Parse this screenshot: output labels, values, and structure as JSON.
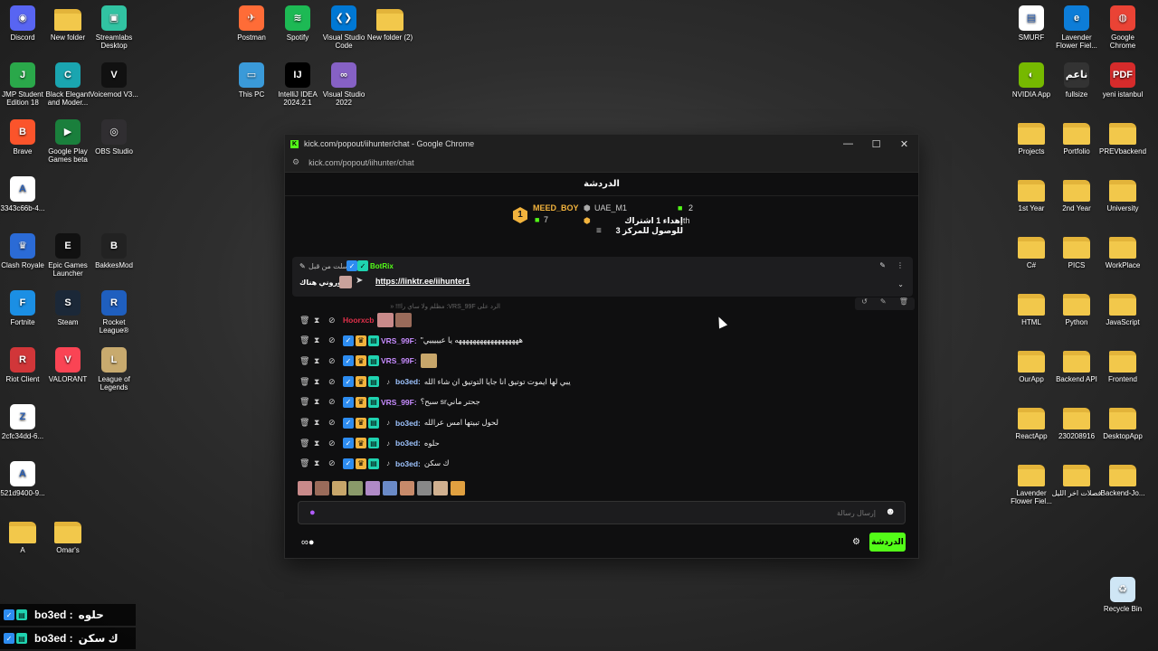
{
  "desktop_left": [
    {
      "label": "Discord",
      "color": "#5865f2",
      "glyph": "◉"
    },
    {
      "label": "New folder",
      "folder": true
    },
    {
      "label": "Streamlabs Desktop",
      "color": "#31c3a2",
      "glyph": "▣"
    },
    {
      "label": "JMP Student Edition 18",
      "color": "#2aa84a",
      "glyph": "J"
    },
    {
      "label": "Black Elegant and Moder...",
      "color": "#1aa5b0",
      "glyph": "C"
    },
    {
      "label": "Voicemod V3...",
      "color": "#111111",
      "glyph": "V"
    },
    {
      "label": "Brave",
      "color": "#fb542b",
      "glyph": "B"
    },
    {
      "label": "Google Play Games beta",
      "color": "#1a7f3c",
      "glyph": "▶"
    },
    {
      "label": "OBS Studio",
      "color": "#302e31",
      "glyph": "◎"
    },
    {
      "label": "3343c66b-4...",
      "color": "#ffffff",
      "glyph": "A"
    },
    {
      "label": "Clash Royale",
      "color": "#2b6bd6",
      "glyph": "♛"
    },
    {
      "label": "Epic Games Launcher",
      "color": "#111111",
      "glyph": "E"
    },
    {
      "label": "BakkesMod",
      "color": "#222222",
      "glyph": "B"
    },
    {
      "label": "Fortnite",
      "color": "#1b8fe4",
      "glyph": "F"
    },
    {
      "label": "Steam",
      "color": "#1b2838",
      "glyph": "S"
    },
    {
      "label": "Rocket League®",
      "color": "#1f5fbf",
      "glyph": "R"
    },
    {
      "label": "Riot Client",
      "color": "#d13639",
      "glyph": "R"
    },
    {
      "label": "VALORANT",
      "color": "#fa4454",
      "glyph": "V"
    },
    {
      "label": "League of Legends",
      "color": "#c8aa6e",
      "glyph": "L"
    },
    {
      "label": "2cfc34dd-6...",
      "color": "#ffffff",
      "glyph": "Z"
    },
    {
      "label": "521d9400-9...",
      "color": "#ffffff",
      "glyph": "A"
    },
    {
      "label": "A",
      "folder": true
    },
    {
      "label": "Omar's",
      "folder": true
    }
  ],
  "desktop_top": [
    {
      "label": "Postman",
      "color": "#ff6c37",
      "glyph": "✈"
    },
    {
      "label": "Spotify",
      "color": "#1db954",
      "glyph": "≋"
    },
    {
      "label": "Visual Studio Code",
      "color": "#0078d4",
      "glyph": "❮❯"
    },
    {
      "label": "New folder (2)",
      "folder": true
    },
    {
      "label": "This PC",
      "color": "#3a9ad9",
      "glyph": "▭"
    },
    {
      "label": "IntelliJ IDEA 2024.2.1",
      "color": "#000000",
      "glyph": "IJ"
    },
    {
      "label": "Visual Studio 2022",
      "color": "#8661c5",
      "glyph": "∞"
    }
  ],
  "desktop_right": [
    {
      "label": "SMURF",
      "color": "#ffffff",
      "glyph": "▤"
    },
    {
      "label": "Lavender Flower Fiel...",
      "color": "#0d7dd8",
      "glyph": "e"
    },
    {
      "label": "Google Chrome",
      "color": "#ea4335",
      "glyph": "◍"
    },
    {
      "label": "NVIDIA App",
      "color": "#76b900",
      "glyph": "◐"
    },
    {
      "label": "fullsize",
      "color": "#333333",
      "glyph": "ناعم"
    },
    {
      "label": "yeni istanbul",
      "color": "#d62b2b",
      "glyph": "PDF"
    },
    {
      "label": "Projects",
      "folder": true
    },
    {
      "label": "Portfolio",
      "folder": true
    },
    {
      "label": "PREVbackend",
      "folder": true
    },
    {
      "label": "1st Year",
      "folder": true
    },
    {
      "label": "2nd Year",
      "folder": true
    },
    {
      "label": "University",
      "folder": true
    },
    {
      "label": "C#",
      "folder": true
    },
    {
      "label": "PICS",
      "folder": true
    },
    {
      "label": "WorkPlace",
      "folder": true
    },
    {
      "label": "HTML",
      "folder": true
    },
    {
      "label": "Python",
      "folder": true
    },
    {
      "label": "JavaScript",
      "folder": true
    },
    {
      "label": "OurApp",
      "folder": true
    },
    {
      "label": "Backend API",
      "folder": true
    },
    {
      "label": "Frontend",
      "folder": true
    },
    {
      "label": "ReactApp",
      "folder": true
    },
    {
      "label": "230208916",
      "folder": true
    },
    {
      "label": "DesktopApp",
      "folder": true
    },
    {
      "label": "Lavender Flower Fiel...",
      "folder": true
    },
    {
      "label": "فصلات اخر الليل",
      "folder": true
    },
    {
      "label": "Backend-Jo...",
      "folder": true
    },
    {
      "label": "Recycle Bin",
      "color": "#cfe6f5",
      "glyph": "♻"
    }
  ],
  "window": {
    "title": "kick.com/popout/iihunter/chat - Google Chrome",
    "url": "kick.com/popout/iihunter/chat",
    "min": "—",
    "max": "☐",
    "close": "✕"
  },
  "chat": {
    "header": "الدردشة",
    "leaderboard": {
      "rank": "1",
      "top_user": "MEED_BOY",
      "top_count": "7",
      "second_user": "UAE_M1",
      "second_count": "2",
      "gift_line": "إهداء 1 اشتراك للوصول للمركز 3",
      "gift_suffix": "th"
    },
    "pinned": {
      "by_label": "أرسلت من قبل",
      "user": "BotRix",
      "link": "https://linktr.ee/iihunter1",
      "text": "اتوروني هناك"
    },
    "reply_hint": "الرد على VRS_99F: مظلم ولا ساي را!!! «",
    "messages": [
      {
        "user": "Hoorxcb",
        "color": "#e0304a",
        "text": "",
        "emotes": 2
      },
      {
        "user": "VRS_99F:",
        "color": "#c78cff",
        "text": "\"ههههههههههههههههههه يا عيييييي",
        "emotes": 0
      },
      {
        "user": "VRS_99F:",
        "color": "#c78cff",
        "text": "",
        "emotes": 1
      },
      {
        "user": "bo3ed:",
        "color": "#9ec4ff",
        "text": "يبي لها ايموت توتيق انا جايا التوتيق ان شاء الله",
        "emotes": 0
      },
      {
        "user": "VRS_99F:",
        "color": "#c78cff",
        "text": "سبح؟ srجحتر ماني",
        "emotes": 0
      },
      {
        "user": "bo3ed:",
        "color": "#9ec4ff",
        "text": "لحول تبيتها امس عرالله",
        "emotes": 0
      },
      {
        "user": "bo3ed:",
        "color": "#9ec4ff",
        "text": "حلوه",
        "emotes": 0
      },
      {
        "user": "bo3ed:",
        "color": "#9ec4ff",
        "text": "ك سكن",
        "emotes": 0
      }
    ],
    "emote_bar_count": 10,
    "input_placeholder": "إرسال رسالة",
    "send_label": "الدردشة"
  },
  "overlay": [
    {
      "user": "bo3ed :",
      "text": "حلوه"
    },
    {
      "user": "bo3ed :",
      "text": "ك سكن"
    }
  ],
  "colors": {
    "kick_green": "#53fc18",
    "folder": "#f2c84b"
  }
}
